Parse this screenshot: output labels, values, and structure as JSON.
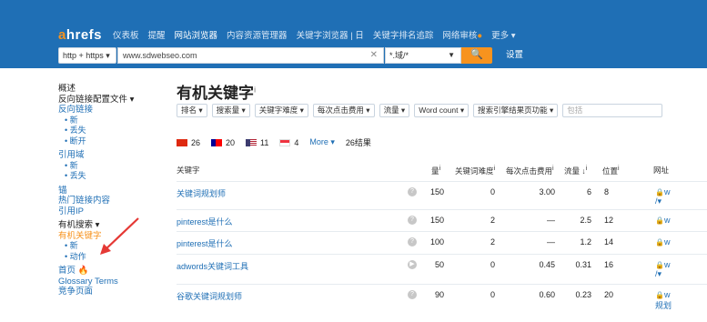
{
  "app": {
    "logo": "ahrefs"
  },
  "nav": {
    "items": [
      {
        "label": "仪表板"
      },
      {
        "label": "提醒"
      },
      {
        "label": "网站浏览器",
        "active": true
      },
      {
        "label": "内容资源管理器"
      },
      {
        "label": "关键字浏览器 | 日"
      },
      {
        "label": "关键字排名追踪"
      },
      {
        "label": "网络审核",
        "badge": "●"
      },
      {
        "label": "更多 ▾"
      }
    ]
  },
  "search": {
    "protocol": "http + https ▾",
    "url": "www.sdwebseo.com",
    "clear": "✕",
    "mode": "*.域/*",
    "mode_caret": "▼",
    "button": "🔍",
    "settings": "设置"
  },
  "sidebar": {
    "items": [
      {
        "label": "概述",
        "type": "hd"
      },
      {
        "label": "反向链接配置文件 ▾",
        "type": "hd"
      },
      {
        "label": "反向链接",
        "type": "lk"
      },
      {
        "label": "• 新",
        "type": "sub"
      },
      {
        "label": "• 丢失",
        "type": "sub"
      },
      {
        "label": "• 断开",
        "type": "sub"
      },
      {
        "label": "引用域",
        "type": "lk",
        "gap": true
      },
      {
        "label": "• 新",
        "type": "sub"
      },
      {
        "label": "• 丢失",
        "type": "sub"
      },
      {
        "label": "锚",
        "type": "lk",
        "gap": true
      },
      {
        "label": "热门链接内容",
        "type": "lk"
      },
      {
        "label": "引用IP",
        "type": "lk"
      },
      {
        "label": "有机搜索 ▾",
        "type": "hd",
        "gap": true
      },
      {
        "label": "有机关键字",
        "type": "act"
      },
      {
        "label": "• 新",
        "type": "sub"
      },
      {
        "label": "• 动作",
        "type": "sub"
      },
      {
        "label": "首页 🔥",
        "type": "lk",
        "gap": true
      },
      {
        "label": "Glossary Terms",
        "type": "lk"
      },
      {
        "label": "竞争页面",
        "type": "lk"
      }
    ]
  },
  "main": {
    "title": "有机关键字",
    "title_sup": "i",
    "filters": [
      "排名 ▾",
      "搜索量 ▾",
      "关键字难度 ▾",
      "每次点击费用 ▾",
      "流量 ▾",
      "Word count ▾",
      "搜索引擎结果页功能 ▾"
    ],
    "filter_placeholder": "包括",
    "countries": [
      {
        "count": "26",
        "color": "#de2910"
      },
      {
        "count": "20",
        "color": "#fe0000"
      },
      {
        "count": "11",
        "color": "#3c3b6e"
      },
      {
        "count": "4",
        "color": "#ef3340"
      }
    ],
    "more": "More ▾",
    "total": "26结果",
    "columns": [
      "关键字",
      "量",
      "关键词难度",
      "每次点击费用",
      "流量 ↓",
      "位置",
      "网址"
    ],
    "col_info": "i",
    "rows": [
      {
        "keyword": "关键词规划师",
        "serp": "?",
        "volume": "150",
        "kd": "0",
        "cpc": "3.00",
        "traffic": "6",
        "position": "8",
        "url": "w",
        "url_sub": "/▾"
      },
      {
        "keyword": "pinterest是什么",
        "serp": "?",
        "volume": "150",
        "kd": "2",
        "cpc": "—",
        "traffic": "2.5",
        "position": "12",
        "url": "w",
        "url_sub": ""
      },
      {
        "keyword": "pinterest是什么",
        "serp": "?",
        "volume": "100",
        "kd": "2",
        "cpc": "—",
        "traffic": "1.2",
        "position": "14",
        "url": "w",
        "url_sub": ""
      },
      {
        "keyword": "adwords关键词工具",
        "serp": "▶",
        "volume": "50",
        "kd": "0",
        "cpc": "0.45",
        "traffic": "0.31",
        "position": "16",
        "url": "w",
        "url_sub": "/▾"
      },
      {
        "keyword": "谷歌关键词规划师",
        "serp": "?",
        "volume": "90",
        "kd": "0",
        "cpc": "0.60",
        "traffic": "0.23",
        "position": "20",
        "url": "w",
        "url_sub": "规划"
      }
    ]
  },
  "colors": {
    "header": "#1f6fb5",
    "accent": "#f7931e",
    "link": "#1f6fb5",
    "annotation": "#e53935"
  }
}
